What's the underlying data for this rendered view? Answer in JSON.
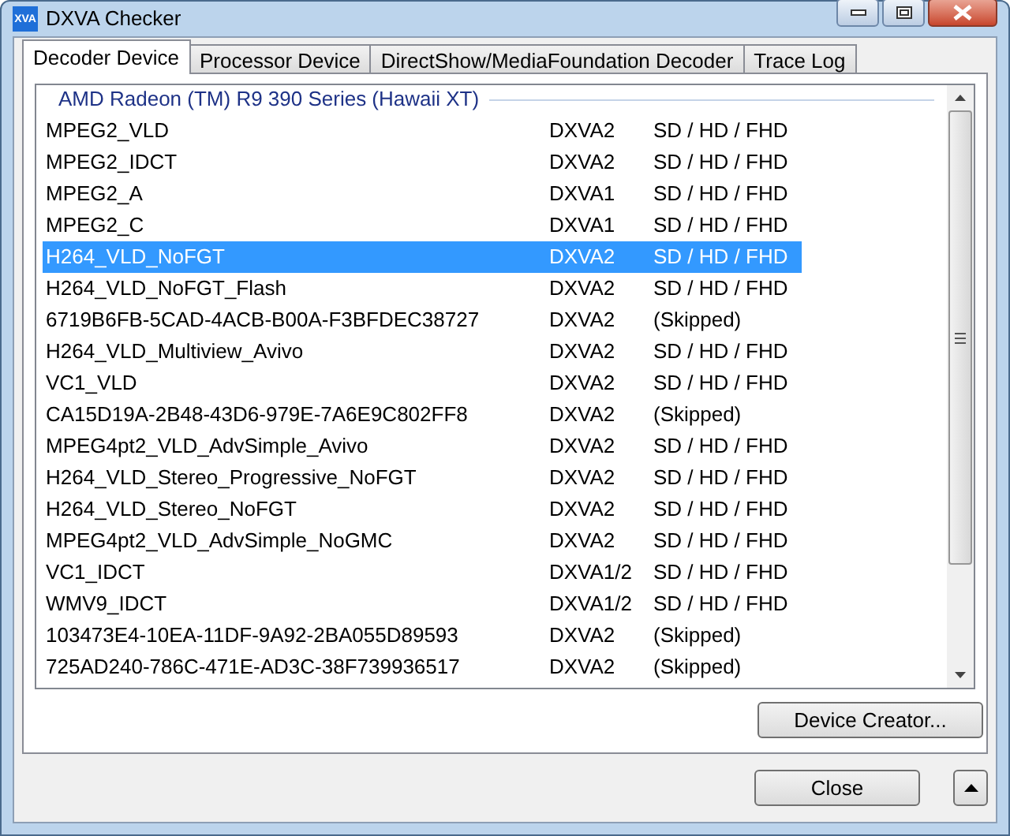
{
  "window": {
    "title": "DXVA Checker",
    "icon_text": "XVA"
  },
  "tabs": [
    {
      "label": "Decoder Device",
      "selected": true
    },
    {
      "label": "Processor Device",
      "selected": false
    },
    {
      "label": "DirectShow/MediaFoundation Decoder",
      "selected": false
    },
    {
      "label": "Trace Log",
      "selected": false
    }
  ],
  "group": {
    "title": "AMD Radeon (TM) R9 390 Series (Hawaii XT)"
  },
  "rows": [
    {
      "name": "MPEG2_VLD",
      "api": "DXVA2",
      "support": "SD / HD / FHD",
      "selected": false
    },
    {
      "name": "MPEG2_IDCT",
      "api": "DXVA2",
      "support": "SD / HD / FHD",
      "selected": false
    },
    {
      "name": "MPEG2_A",
      "api": "DXVA1",
      "support": "SD / HD / FHD",
      "selected": false
    },
    {
      "name": "MPEG2_C",
      "api": "DXVA1",
      "support": "SD / HD / FHD",
      "selected": false
    },
    {
      "name": "H264_VLD_NoFGT",
      "api": "DXVA2",
      "support": "SD / HD / FHD",
      "selected": true
    },
    {
      "name": "H264_VLD_NoFGT_Flash",
      "api": "DXVA2",
      "support": "SD / HD / FHD",
      "selected": false
    },
    {
      "name": "6719B6FB-5CAD-4ACB-B00A-F3BFDEC38727",
      "api": "DXVA2",
      "support": "(Skipped)",
      "selected": false
    },
    {
      "name": "H264_VLD_Multiview_Avivo",
      "api": "DXVA2",
      "support": "SD / HD / FHD",
      "selected": false
    },
    {
      "name": "VC1_VLD",
      "api": "DXVA2",
      "support": "SD / HD / FHD",
      "selected": false
    },
    {
      "name": "CA15D19A-2B48-43D6-979E-7A6E9C802FF8",
      "api": "DXVA2",
      "support": "(Skipped)",
      "selected": false
    },
    {
      "name": "MPEG4pt2_VLD_AdvSimple_Avivo",
      "api": "DXVA2",
      "support": "SD / HD / FHD",
      "selected": false
    },
    {
      "name": "H264_VLD_Stereo_Progressive_NoFGT",
      "api": "DXVA2",
      "support": "SD / HD / FHD",
      "selected": false
    },
    {
      "name": "H264_VLD_Stereo_NoFGT",
      "api": "DXVA2",
      "support": "SD / HD / FHD",
      "selected": false
    },
    {
      "name": "MPEG4pt2_VLD_AdvSimple_NoGMC",
      "api": "DXVA2",
      "support": "SD / HD / FHD",
      "selected": false
    },
    {
      "name": "VC1_IDCT",
      "api": "DXVA1/2",
      "support": "SD / HD / FHD",
      "selected": false
    },
    {
      "name": "WMV9_IDCT",
      "api": "DXVA1/2",
      "support": "SD / HD / FHD",
      "selected": false
    },
    {
      "name": "103473E4-10EA-11DF-9A92-2BA055D89593",
      "api": "DXVA2",
      "support": "(Skipped)",
      "selected": false
    },
    {
      "name": "725AD240-786C-471E-AD3C-38F739936517",
      "api": "DXVA2",
      "support": "(Skipped)",
      "selected": false
    }
  ],
  "device_creator_button": "Device Creator...",
  "close_button": "Close"
}
